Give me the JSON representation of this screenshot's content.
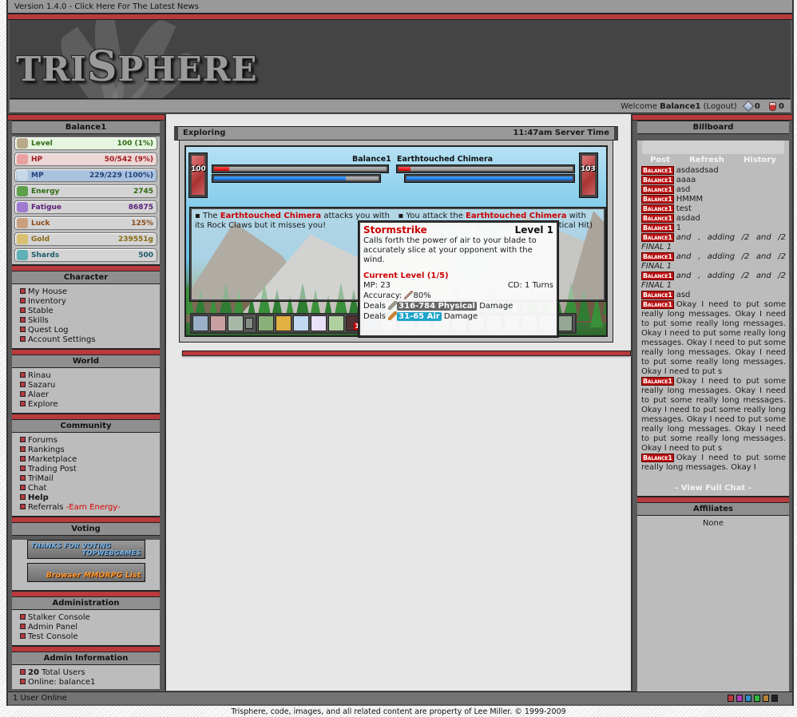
{
  "header": {
    "version_text": "Version 1.4.0 - Click Here For The Latest News",
    "logo_main": "TRI",
    "logo_s": "S",
    "logo_rest": "PHERE",
    "welcome_prefix": "Welcome",
    "username": "Balance1",
    "logout_label": "(Logout)",
    "gems_count": "0",
    "potions_count": "0"
  },
  "character_panel": {
    "title": "Balance1",
    "stats": [
      {
        "label": "Level",
        "value": "100 (1%)",
        "color": "#2e6b12",
        "bg": "#e6f5df",
        "icon": "sword-level-icon"
      },
      {
        "label": "HP",
        "value": "50/542 (9%)",
        "color": "#a01b1b",
        "bg": "#edd6d6",
        "icon": "heart-icon"
      },
      {
        "label": "MP",
        "value": "229/229 (100%)",
        "color": "#1f3f78",
        "bg": "#a9c2de",
        "icon": "mana-icon"
      },
      {
        "label": "Energy",
        "value": "2745",
        "color": "#2e6b12",
        "bg": "#d4d4d4",
        "icon": "energy-icon"
      },
      {
        "label": "Fatigue",
        "value": "86875",
        "color": "#5a1f7a",
        "bg": "#d4d4d4",
        "icon": "fatigue-icon"
      },
      {
        "label": "Luck",
        "value": "125%",
        "color": "#8a4a1a",
        "bg": "#d4d4d4",
        "icon": "luck-icon"
      },
      {
        "label": "Gold",
        "value": "239551g",
        "color": "#8a6a10",
        "bg": "#d4d4d4",
        "icon": "gold-icon"
      },
      {
        "label": "Shards",
        "value": "500",
        "color": "#1a5a6a",
        "bg": "#d4d4d4",
        "icon": "shards-icon"
      }
    ]
  },
  "nav": {
    "character": {
      "title": "Character",
      "items": [
        "My House",
        "Inventory",
        "Stable",
        "Skills",
        "Quest Log",
        "Account Settings"
      ]
    },
    "world": {
      "title": "World",
      "items": [
        "Rinau",
        "Sazaru",
        "Alaer",
        "Explore"
      ]
    },
    "community": {
      "title": "Community",
      "items": [
        "Forums",
        "Rankings",
        "Marketplace",
        "Trading Post",
        "TriMail",
        "Chat",
        "Help",
        "Referrals"
      ],
      "referral_note": "-Earn Energy-"
    },
    "voting": {
      "title": "Voting",
      "topweb_line1": "THANKS FOR VOTING",
      "topweb_line2": "TOPWEBGAMES",
      "mmorpg_label": "Browser MMORPG List"
    },
    "administration": {
      "title": "Administration",
      "items": [
        "Stalker Console",
        "Admin Panel",
        "Test Console"
      ]
    },
    "admin_info": {
      "title": "Admin Information",
      "total_users_count": "20",
      "total_users_label": "Total Users",
      "online_label": "Online: balance1"
    }
  },
  "explore": {
    "title": "Exploring",
    "server_time": "11:47am Server Time",
    "player": {
      "name": "Balance1",
      "level": "100",
      "hp_fraction": 0.09,
      "mp_fraction": 0.8
    },
    "enemy": {
      "name": "Earthtouched Chimera",
      "level": "103",
      "hp_fraction": 0.07,
      "mp_fraction": 1.0
    },
    "log": {
      "left_pre": "The",
      "left_name": "Earthtouched Chimera",
      "left_post": "attacks you with its Rock Claws but it misses you!",
      "right_pre": "You attack the",
      "right_name": "Earthtouched Chimera",
      "right_post": "with Power Slash, dealing 1315 damage! (Critical Hit)"
    },
    "tooltip": {
      "name": "Stormstrike",
      "level": "Level 1",
      "description": "Calls forth the power of air to your blade to accurately slice at your opponent with the wind.",
      "current_level": "Current Level (1/5)",
      "mp": "MP: 23",
      "cd": "CD: 1 Turns",
      "accuracy_label": "Accuracy:",
      "accuracy_value": "80%",
      "deals_label": "Deals",
      "phys_range": "316-784 Physical",
      "air_range": "31-65 Air",
      "damage_label": "Damage"
    },
    "skills_group1": [
      "recover-icon",
      "potion-icon",
      "boot-icon"
    ],
    "skills_group2": [
      "power-slash-icon",
      "golden-axe-icon",
      "shield-bash-icon",
      "lightning-claw-icon",
      "stormstrike-icon",
      "dark-blade-icon",
      "cross-blade-icon"
    ],
    "dark_blade_badge": "1",
    "empty_slots": 11
  },
  "billboard": {
    "title": "Billboard",
    "actions": [
      "Post",
      "Refresh",
      "History"
    ],
    "messages": [
      {
        "user": "Balance1",
        "text": "asdasdsad",
        "italic": false
      },
      {
        "user": "Balance1",
        "text": "aaaa",
        "italic": false
      },
      {
        "user": "Balance1",
        "text": "asd",
        "italic": false
      },
      {
        "user": "Balance1",
        "text": "HMMM",
        "italic": false
      },
      {
        "user": "Balance1",
        "text": "test",
        "italic": false
      },
      {
        "user": "Balance1",
        "text": "asdad",
        "italic": false
      },
      {
        "user": "Balance1",
        "text": "1",
        "italic": false
      },
      {
        "user": "Balance1",
        "text": "and , adding /2 and /2 FINAL 1",
        "italic": true
      },
      {
        "user": "Balance1",
        "text": "and , adding /2 and /2 FINAL 1",
        "italic": true
      },
      {
        "user": "Balance1",
        "text": "and , adding /2 and /2 FINAL 1",
        "italic": true
      },
      {
        "user": "Balance1",
        "text": "asd",
        "italic": false
      },
      {
        "user": "Balance1",
        "text": "Okay I need to put some really long messages. Okay I need to put some really long messages. Okay I need to put some really long messages. Okay I need to put some really long messages. Okay I need to put some really long messages. Okay I need to put s",
        "italic": false
      },
      {
        "user": "Balance1",
        "text": "Okay I need to put some really long messages. Okay I need to put some really long messages. Okay I need to put some really long messages. Okay I need to put some really long messages. Okay I need to put some really long messages. Okay I need to put s",
        "italic": false
      },
      {
        "user": "Balance1",
        "text": "Okay I need to put some really long messages. Okay I",
        "italic": false
      }
    ],
    "view_full_chat": "- View Full Chat -"
  },
  "affiliates": {
    "title": "Affiliates",
    "value": "None"
  },
  "footer": {
    "users_online": "1 User Online",
    "theme_swatches": [
      "#b83a3c",
      "#b23ab8",
      "#2f8fc8",
      "#2fb83a",
      "#b8843a",
      "#222222"
    ],
    "copyright": "Trisphere, code, images, and all related content are property of Lee Miller. © 1999-2009"
  }
}
